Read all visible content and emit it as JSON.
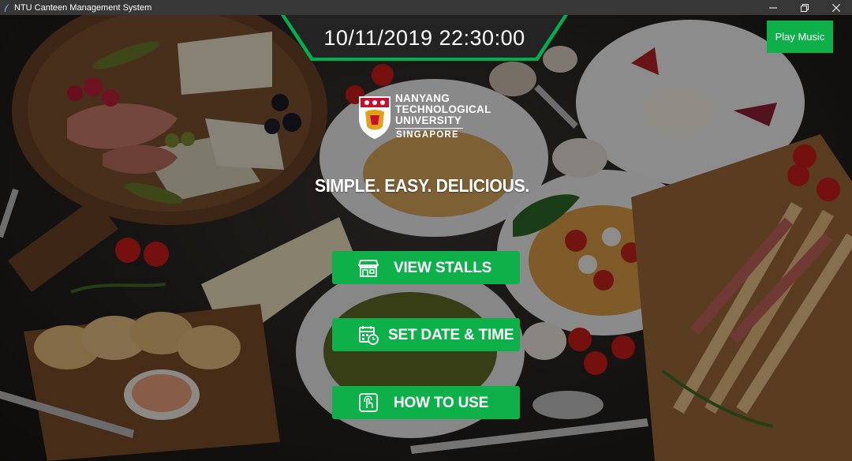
{
  "window": {
    "title": "NTU Canteen Management System",
    "controls": [
      "minimize-icon",
      "restore-icon",
      "close-icon"
    ]
  },
  "header": {
    "datetime": "10/11/2019 22:30:00"
  },
  "music": {
    "label": "Play Music"
  },
  "logo": {
    "line1": "NANYANG",
    "line2": "TECHNOLOGICAL",
    "line3": "UNIVERSITY",
    "line4": "SINGAPORE"
  },
  "tagline": "SIMPLE. EASY. DELICIOUS.",
  "menu": [
    {
      "label": "VIEW STALLS",
      "icon": "storefront-icon"
    },
    {
      "label": "SET DATE & TIME",
      "icon": "calendar-clock-icon"
    },
    {
      "label": "HOW TO USE",
      "icon": "touch-hand-icon"
    }
  ],
  "colors": {
    "accent": "#0eb04a",
    "titlebar": "#373737"
  }
}
